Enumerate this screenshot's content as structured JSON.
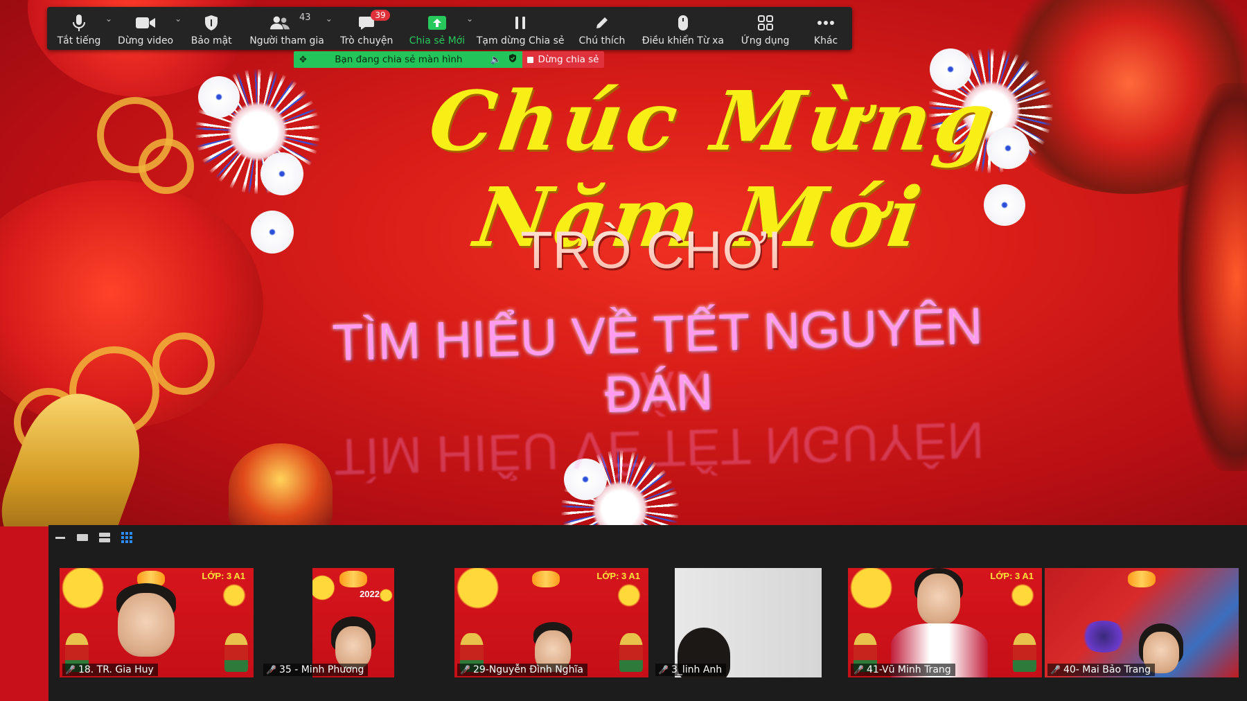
{
  "toolbar": {
    "mute": "Tắt tiếng",
    "stop_video": "Dừng video",
    "security": "Bảo mật",
    "participants": "Người tham gia",
    "participants_count": "43",
    "chat": "Trò chuyện",
    "chat_badge": "39",
    "new_share": "Chia sẻ Mới",
    "pause_share": "Tạm dừng Chia sẻ",
    "annotate": "Chú thích",
    "remote_control": "Điều khiển Từ xa",
    "apps": "Ứng dụng",
    "more": "Khác"
  },
  "share_banner": {
    "text": "Bạn đang chia sẻ màn hình",
    "stop": "Dừng chia sẻ"
  },
  "slide": {
    "greeting": "Chúc Mừng Năm Mới",
    "title": "TRÒ CHƠI",
    "subtitle": "TÌM HIỂU VỀ TẾT NGUYÊN ĐÁN"
  },
  "gallery": {
    "class_label": "LỚP: 3 A1",
    "year": "2022",
    "participants": [
      {
        "name": "18. TR. Gia Huy",
        "background": "tet"
      },
      {
        "name": "35 - Minh Phương",
        "background": "tet"
      },
      {
        "name": "29-Nguyễn Đình Nghĩa",
        "background": "tet"
      },
      {
        "name": "3_linh Anh",
        "background": "room"
      },
      {
        "name": "41-Vũ Minh Trang",
        "background": "tet"
      },
      {
        "name": "40- Mai Bảo Trang",
        "background": "room"
      }
    ]
  },
  "colors": {
    "toolbar_bg": "#242424",
    "share_green": "#23c55a",
    "stop_red": "#e0323d",
    "slide_red": "#d81d18",
    "greeting_yellow": "#f8ef17",
    "subtitle_pink": "#ff9cf0"
  }
}
